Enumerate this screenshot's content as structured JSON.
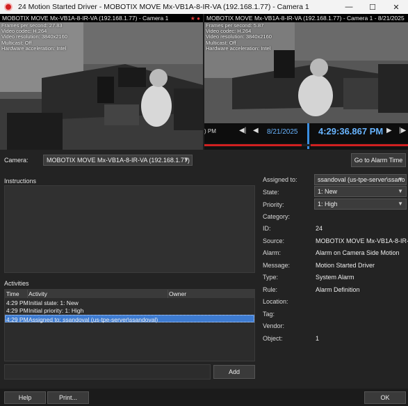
{
  "window": {
    "title": "24 Motion Started Driver - MOBOTIX MOVE Mx-VB1A-8-IR-VA (192.168.1.77) - Camera 1"
  },
  "video_left": {
    "header": "MOBOTIX MOVE Mx-VB1A-8-IR-VA (192.168.1.77) - Camera 1",
    "stats": [
      "Frames per second: 27.83",
      "Video codec: H.264",
      "Video resolution: 3840x2160",
      "Multicast: Off",
      "Hardware acceleration: Intel"
    ]
  },
  "video_right": {
    "header": "MOBOTIX MOVE Mx-VB1A-8-IR-VA (192.168.1.77) - Camera 1 - 8/21/2025",
    "stats": [
      "Frames per second: 5.87",
      "Video codec: H.264",
      "Video resolution: 3840x2160",
      "Multicast: Off",
      "Hardware acceleration: Intel"
    ],
    "timeline_edge": ") PM",
    "date": "8/21/2025",
    "time": "4:29:36.867 PM"
  },
  "camera": {
    "label": "Camera:",
    "value": "MOBOTIX MOVE Mx-VB1A-8-IR-VA (192.168.1.77)",
    "go_to_alarm": "Go to Alarm Time"
  },
  "instructions": {
    "label": "Instructions"
  },
  "activities": {
    "label": "Activities",
    "columns": [
      "Time",
      "Activity",
      "Owner"
    ],
    "rows": [
      {
        "time": "4:29 PM",
        "activity": "Initial state: 1: New",
        "owner": ""
      },
      {
        "time": "4:29 PM",
        "activity": "Initial priority: 1: High",
        "owner": ""
      },
      {
        "time": "4:29 PM",
        "activity": "Assigned to: ssandoval (us-tpe-server\\ssandoval)",
        "owner": ""
      }
    ],
    "add_button": "Add",
    "comment_value": ""
  },
  "properties": {
    "assigned_to": {
      "label": "Assigned to:",
      "value": "ssandoval (us-tpe-server\\ssano"
    },
    "state": {
      "label": "State:",
      "value": "1: New"
    },
    "priority": {
      "label": "Priority:",
      "value": "1: High"
    },
    "category": {
      "label": "Category:",
      "value": ""
    },
    "id": {
      "label": "ID:",
      "value": "24"
    },
    "source": {
      "label": "Source:",
      "value": "MOBOTIX MOVE Mx-VB1A-8-IR-..."
    },
    "alarm": {
      "label": "Alarm:",
      "value": "Alarm on Camera Side Motion"
    },
    "message": {
      "label": "Message:",
      "value": "Motion Started Driver"
    },
    "type": {
      "label": "Type:",
      "value": "System Alarm"
    },
    "rule": {
      "label": "Rule:",
      "value": "Alarm Definition"
    },
    "location": {
      "label": "Location:",
      "value": ""
    },
    "tag": {
      "label": "Tag:",
      "value": ""
    },
    "vendor": {
      "label": "Vendor:",
      "value": ""
    },
    "object": {
      "label": "Object:",
      "value": "1"
    }
  },
  "footer": {
    "help": "Help",
    "print": "Print...",
    "ok": "OK"
  },
  "colors": {
    "accent": "#3d7bd1",
    "timeline_blue": "#68b4ff",
    "alarm_red": "#d02020",
    "panel_bg": "#232323"
  }
}
